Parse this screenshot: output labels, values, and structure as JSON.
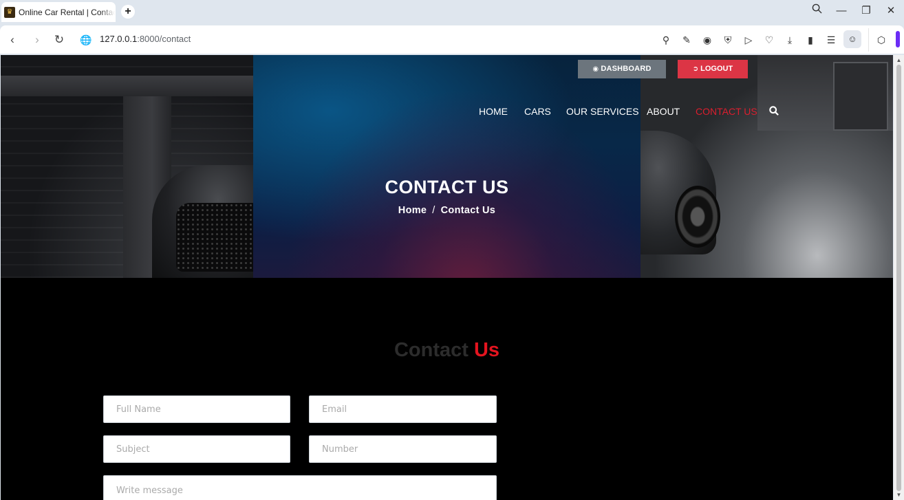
{
  "browser": {
    "tab_title": "Online Car Rental | Contact",
    "new_tab": "+",
    "url_host": "127.0.0.1",
    "url_rest": ":8000/contact",
    "window_controls": [
      "search-icon",
      "minimize-icon",
      "restore-icon",
      "close-icon"
    ]
  },
  "header": {
    "dashboard_label": "DASHBOARD",
    "logout_label": "LOGOUT",
    "nav": [
      {
        "label": "HOME"
      },
      {
        "label": "CARS"
      },
      {
        "label": "OUR SERVICES"
      },
      {
        "label": "ABOUT"
      },
      {
        "label": "CONTACT US",
        "active": true
      }
    ]
  },
  "hero": {
    "title": "CONTACT US",
    "breadcrumb_home": "Home",
    "breadcrumb_sep": "/",
    "breadcrumb_current": "Contact Us"
  },
  "contact": {
    "heading_a": "Contact",
    "heading_b": "Us",
    "full_name_placeholder": "Full Name",
    "email_placeholder": "Email",
    "subject_placeholder": "Subject",
    "number_placeholder": "Number",
    "message_placeholder": "Write message"
  },
  "colors": {
    "accent_red": "#dc3545",
    "active_nav": "#dc1e2e",
    "dashboard_gray": "#6c757d",
    "section_bg": "#000000"
  }
}
